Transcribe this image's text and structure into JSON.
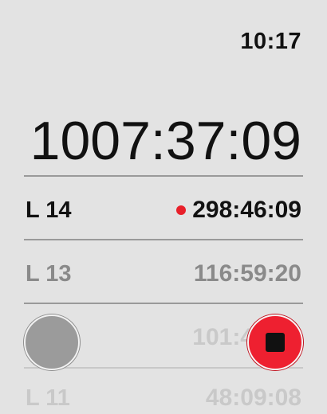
{
  "status_bar": {
    "time": "10:17"
  },
  "main_timer": "1007:37:09",
  "laps": [
    {
      "label": "L 14",
      "time": "298:46:09",
      "recording": true
    },
    {
      "label": "L 13",
      "time": "116:59:20"
    },
    {
      "label": "",
      "time": "101:4"
    },
    {
      "label": "L 11",
      "time": "48:09:08"
    }
  ],
  "controls": {
    "lap_button": "lap-button",
    "stop_button": "stop-button"
  },
  "colors": {
    "background": "#e3e3e3",
    "accent_red": "#ee2030",
    "lap_button_gray": "#9b9b9b"
  }
}
